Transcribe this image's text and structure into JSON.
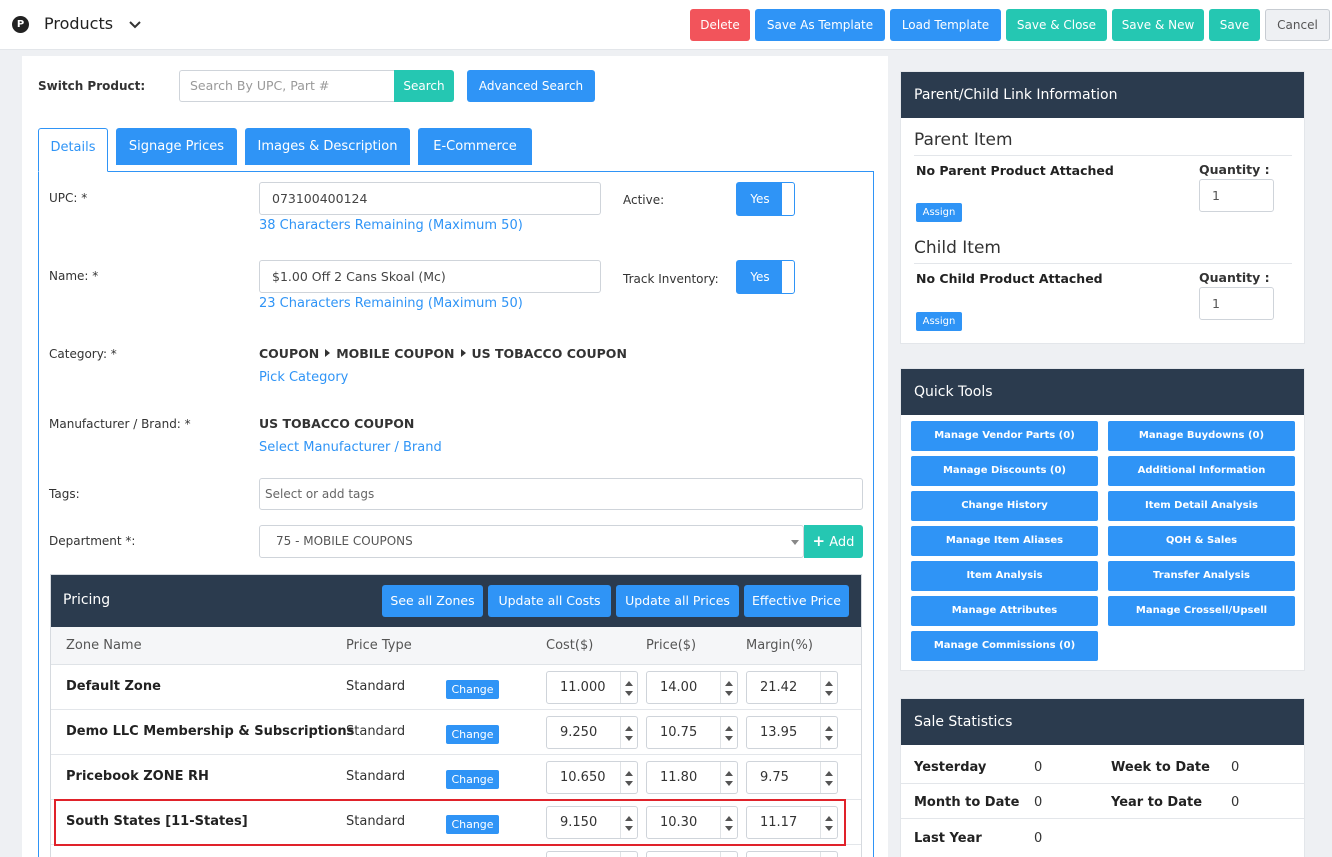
{
  "app": {
    "logo_letter": "P",
    "title": "Products"
  },
  "toolbar": {
    "delete": "Delete",
    "save_template": "Save As Template",
    "load_template": "Load Template",
    "save_close": "Save & Close",
    "save_new": "Save & New",
    "save": "Save",
    "cancel": "Cancel"
  },
  "switch": {
    "label": "Switch Product:",
    "placeholder": "Search By UPC, Part #",
    "search": "Search",
    "advanced": "Advanced Search"
  },
  "tabs": [
    "Details",
    "Signage Prices",
    "Images & Description",
    "E-Commerce"
  ],
  "form": {
    "upc_label": "UPC: *",
    "upc_value": "073100400124",
    "upc_help": "38 Characters Remaining (Maximum 50)",
    "active_label": "Active:",
    "active_value": "Yes",
    "name_label": "Name: *",
    "name_value": "$1.00 Off 2 Cans Skoal (Mc)",
    "name_help": "23 Characters Remaining (Maximum 50)",
    "track_label": "Track Inventory:",
    "track_value": "Yes",
    "category_label": "Category: *",
    "category_path": [
      "COUPON",
      "MOBILE COUPON",
      "US TOBACCO COUPON"
    ],
    "category_link": "Pick Category",
    "manufacturer_label": "Manufacturer / Brand: *",
    "manufacturer_value": "US TOBACCO COUPON",
    "manufacturer_link": "Select Manufacturer / Brand",
    "tags_label": "Tags:",
    "tags_placeholder": "Select or add tags",
    "department_label": "Department *:",
    "department_value": "75 - MOBILE COUPONS",
    "add_label": "Add"
  },
  "pricing": {
    "title": "Pricing",
    "buttons": [
      "See all Zones",
      "Update all Costs",
      "Update all Prices",
      "Effective Price"
    ],
    "columns": [
      "Zone Name",
      "Price Type",
      "Cost($)",
      "Price($)",
      "Margin(%)"
    ],
    "change_label": "Change",
    "rows": [
      {
        "zone": "Default Zone",
        "type": "Standard",
        "cost": "11.000",
        "price": "14.00",
        "margin": "21.42"
      },
      {
        "zone": "Demo LLC Membership & Subscriptions",
        "type": "Standard",
        "cost": "9.250",
        "price": "10.75",
        "margin": "13.95"
      },
      {
        "zone": "Pricebook ZONE RH",
        "type": "Standard",
        "cost": "10.650",
        "price": "11.80",
        "margin": "9.75"
      },
      {
        "zone": "South States [11-States]",
        "type": "Standard",
        "cost": "9.150",
        "price": "10.30",
        "margin": "11.17"
      }
    ]
  },
  "link_info": {
    "title": "Parent/Child Link Information",
    "parent_heading": "Parent Item",
    "parent_status": "No Parent Product Attached",
    "child_heading": "Child Item",
    "child_status": "No Child Product Attached",
    "quantity_label": "Quantity :",
    "parent_qty": "1",
    "child_qty": "1",
    "assign": "Assign"
  },
  "quick_tools": {
    "title": "Quick Tools",
    "items": [
      "Manage Vendor Parts (0)",
      "Manage Buydowns (0)",
      "Manage Discounts (0)",
      "Additional Information",
      "Change History",
      "Item Detail Analysis",
      "Manage Item Aliases",
      "QOH & Sales",
      "Item Analysis",
      "Transfer Analysis",
      "Manage Attributes",
      "Manage Crossell/Upsell",
      "Manage Commissions (0)"
    ]
  },
  "sale_stats": {
    "title": "Sale Statistics",
    "items": [
      {
        "label": "Yesterday",
        "value": "0"
      },
      {
        "label": "Week to Date",
        "value": "0"
      },
      {
        "label": "Month to Date",
        "value": "0"
      },
      {
        "label": "Year to Date",
        "value": "0"
      },
      {
        "label": "Last Year",
        "value": "0"
      }
    ]
  },
  "colors": {
    "primary": "#2f94f6",
    "teal": "#25c7b2",
    "danger": "#f2545b",
    "header_dark": "#2b3b4e",
    "highlight": "#e0222a"
  }
}
